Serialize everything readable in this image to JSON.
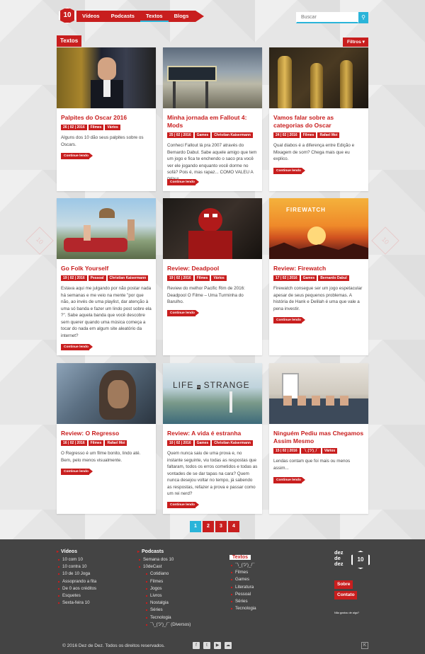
{
  "header": {
    "logo": "10",
    "nav": [
      {
        "label": "Vídeos"
      },
      {
        "label": "Podcasts"
      },
      {
        "label": "Textos"
      },
      {
        "label": "Blogs"
      }
    ],
    "search_placeholder": "Buscar"
  },
  "section": {
    "title": "Textos",
    "filter": "Filtros ▾"
  },
  "cards": [
    {
      "title": "Palpites do Oscar 2016",
      "tags": [
        "26 | 02 | 2016",
        "Filmes",
        "Vários"
      ],
      "excerpt": "Alguns dos 10 dão seus palpites sobre os Oscars.",
      "more": "Continue lendo"
    },
    {
      "title": "Minha jornada em Fallout 4: Mods",
      "tags": [
        "25 | 02 | 2016",
        "Games",
        "Christian Kaisermann"
      ],
      "excerpt": "Conheci Fallout lá pra 2007 através do Bernardo Dabul. Sabe aquele amigo que tem um jogo e fica te enchendo o saco pra você ver ele jogando enquanto você dorme no sofá? Pois é, mas rapaz... COMO VALEU A PENA.",
      "more": "Continue lendo"
    },
    {
      "title": "Vamos falar sobre as categorias do Oscar",
      "tags": [
        "24 | 02 | 2016",
        "Filmes",
        "Rafael Moi"
      ],
      "excerpt": "Qual diabos é a diferença entre Edição e Mixagem de som? Chega mais que eu explico.",
      "more": "Continue lendo"
    },
    {
      "title": "Go Folk Yourself",
      "tags": [
        "19 | 02 | 2016",
        "Pessoal",
        "Christian Kaisermann"
      ],
      "excerpt": "Estava aqui me julgando por não postar nada há semanas e me veio na mente \"por que não, ao invés de uma playlist, dar atenção à uma só banda e fazer um lindo post sobre ela ?\". Sabe aquela banda que você descobre sem querer quando uma música começa a tocar do nada em algum site aleatório da internet?",
      "more": "Continue lendo"
    },
    {
      "title": "Review: Deadpool",
      "tags": [
        "19 | 02 | 2016",
        "Filmes",
        "Vários"
      ],
      "excerpt": "Review do melhor Pacific Rim de 2016: Deadpool O Filme – Uma Turminha do Barulho.",
      "more": "Continue lendo"
    },
    {
      "title": "Review: Firewatch",
      "tags": [
        "17 | 02 | 2016",
        "Games",
        "Bernardo Dabul"
      ],
      "excerpt": "Firewatch consegue ser um jogo espetacular apesar de seus pequenos problemas. A história de Hank e Delilah é uma que vale a pena investir.",
      "more": "Continue lendo"
    },
    {
      "title": "Review: O Regresso",
      "tags": [
        "16 | 02 | 2016",
        "Filmes",
        "Rafael Moi"
      ],
      "excerpt": "O Regresso é um filme bonito, lindo até. Bem, pelo menos visualmente.",
      "more": "Continue lendo"
    },
    {
      "title": "Review: A vida é estranha",
      "tags": [
        "10 | 02 | 2016",
        "Games",
        "Christian Kaisermann"
      ],
      "excerpt": "Quem nunca saiu de uma prova e, no instante seguinte, viu todas as respostas que faltaram, todos os erros cometidos e todas as vontades de se dar tapas na cara? Quem nunca desejou voltar no tempo, já sabendo as respostas, refazer a prova e passar como um rei nerd?",
      "more": "Continue lendo"
    },
    {
      "title": "Ninguém Pediu mas Chegamos Assim Mesmo",
      "tags": [
        "15 | 02 | 2016",
        "¯\\_(ツ)_/¯",
        "Vários"
      ],
      "excerpt": "Lendas contam que foi mais ou menos assim...",
      "more": "Continue lendo"
    }
  ],
  "pagination": [
    "1",
    "2",
    "3",
    "4"
  ],
  "footer": {
    "videos": {
      "title": "Vídeos",
      "items": [
        "10 com 10",
        "10 contra 10",
        "10 de 10 Joga",
        "Assoprando a fita",
        "De 0 aos créditos",
        "Esquetes",
        "Sexta-feira 10"
      ]
    },
    "podcasts": {
      "title": "Podcasts",
      "items": [
        "Semana dos 10",
        "10deCast"
      ],
      "sub": [
        "Cotidiano",
        "Filmes",
        "Jogos",
        "Livros",
        "Nostalgia",
        "Séries",
        "Tecnologia",
        "¯\\_(ツ)_/¯ (Diversos)"
      ]
    },
    "textos": {
      "title": "Textos",
      "items": [
        "¯\\_(ツ)_/¯",
        "Filmes",
        "Games",
        "Literatura",
        "Pessoal",
        "Séries",
        "Tecnologia"
      ]
    },
    "brand_lines": [
      "dez",
      "de",
      "dez"
    ],
    "brand_logo": "10",
    "sobre": "Sobre",
    "contato": "Contato",
    "slogan": "Não gostou de algo?",
    "copyright": "© 2016 Dez de Dez. Todos os direitos reservados.",
    "social": [
      "f",
      "t",
      "▶",
      "☁"
    ],
    "badge": "K"
  },
  "colors": {
    "accent": "#c81e1e",
    "highlight": "#2ab4d9",
    "footer": "#444444"
  }
}
